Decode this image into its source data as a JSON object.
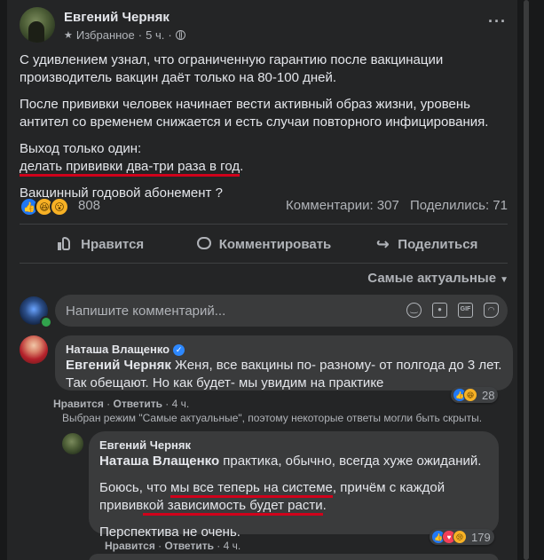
{
  "post": {
    "author": "Евгений Черняк",
    "audience_label": "Избранное",
    "time": "5 ч.",
    "paragraphs": [
      "С удивлением узнал, что ограниченную гарантию после вакцинации производитель вакцин даёт только на 80-100 дней.",
      "После прививки человек начинает вести активный образ жизни, уровень антител со временем снижается и есть случаи повторного инфицирования."
    ],
    "p3_line1": "Выход только один:",
    "p3_underlined": "делать прививки два-три раза в год",
    "p3_end": ".",
    "p4": "Вакцинный годовой абонемент ?",
    "reaction_count": "808",
    "comments_count": "Комментарии: 307",
    "shares_count": "Поделились: 71"
  },
  "actions": {
    "like": "Нравится",
    "comment": "Комментировать",
    "share": "Поделиться"
  },
  "sort_label": "Самые актуальные",
  "composer": {
    "placeholder": "Напишите комментарий..."
  },
  "comment1": {
    "author": "Наташа Влащенко",
    "mention": "Евгений Черняк",
    "text": " Женя, все вакцины по- разному- от полгода до 3 лет. Так обещают. Но как будет- мы увидим на практике",
    "reactions": "28",
    "like": "Нравится",
    "reply": "Ответить",
    "time": "4 ч."
  },
  "notice": "Выбран режим \"Самые актуальные\", поэтому некоторые ответы могли быть скрыты.",
  "comment2": {
    "author": "Евгений Черняк",
    "mention": "Наташа Влащенко",
    "text1": " практика, обычно, всегда хуже ожиданий.",
    "p2_a": "Боюсь, что ",
    "p2_u1": "мы все теперь на системе",
    "p2_b": ", причём с каждой",
    "p2_c": "привив",
    "p2_u2": "кой зависимость будет расти",
    "p2_d": ".",
    "p3": "Перспектива не очень.",
    "reactions": "179",
    "like": "Нравится",
    "reply": "Ответить",
    "time": "4 ч."
  },
  "colors": {
    "background": "#18191a",
    "card": "#242526",
    "bubble": "#3a3b3c",
    "underline": "#d0021b",
    "like_blue": "#2078f4"
  },
  "icons": [
    "star-icon",
    "globe-icon",
    "more-icon",
    "like-icon",
    "comment-icon",
    "share-icon",
    "emoji-icon",
    "camera-icon",
    "gif-icon",
    "sticker-icon",
    "verified-icon"
  ]
}
